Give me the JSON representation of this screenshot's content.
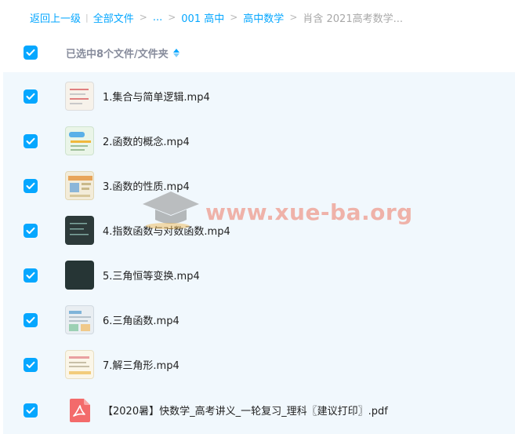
{
  "breadcrumb": {
    "back": "返回上一级",
    "all_files": "全部文件",
    "ellipsis": "...",
    "level1": "001 高中",
    "level2": "高中数学",
    "current": "肖含 2021高考数学..."
  },
  "header": {
    "selected_label": "已选中8个文件/文件夹"
  },
  "files": [
    {
      "name": "1.集合与简单逻辑.mp4",
      "type": "video"
    },
    {
      "name": "2.函数的概念.mp4",
      "type": "video"
    },
    {
      "name": "3.函数的性质.mp4",
      "type": "video"
    },
    {
      "name": "4.指数函数与对数函数.mp4",
      "type": "video"
    },
    {
      "name": "5.三角恒等变换.mp4",
      "type": "video"
    },
    {
      "name": "6.三角函数.mp4",
      "type": "video"
    },
    {
      "name": "7.解三角形.mp4",
      "type": "video"
    },
    {
      "name": "【2020暑】快数学_高考讲义_一轮复习_理科〖建议打印〗.pdf",
      "type": "pdf"
    }
  ],
  "watermark": "www.xue-ba.org",
  "colors": {
    "accent": "#06a7ff",
    "list_bg": "#f1f8fd",
    "pdf_red": "#f36b6b"
  }
}
